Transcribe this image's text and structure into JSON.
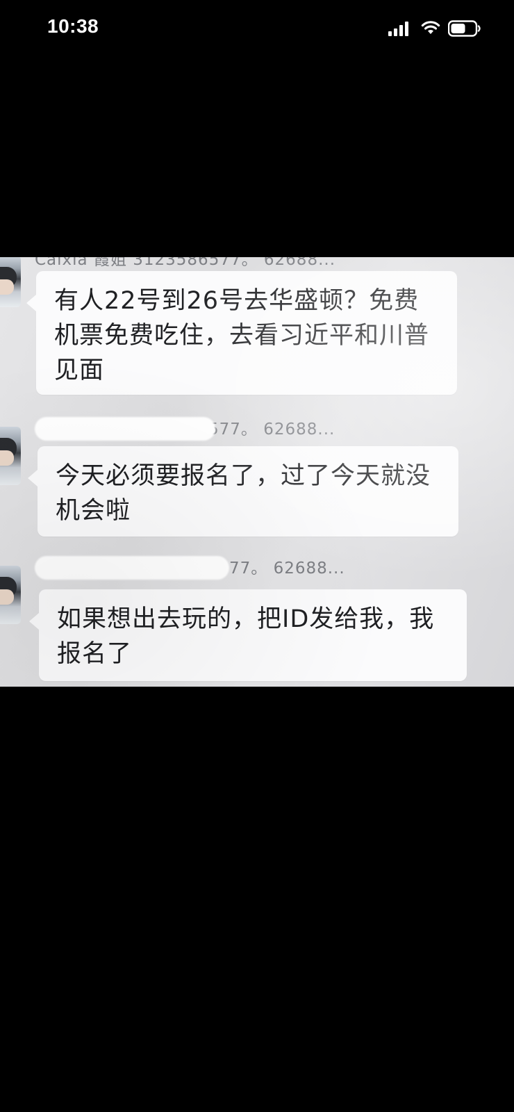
{
  "status_bar": {
    "time": "10:38"
  },
  "messages": [
    {
      "sender_visible_text": "Caixia 霞姐 3123586577。 62688...",
      "text_lines": [
        "有人22号到26号去华盛顿？免费",
        "机票免费吃住，去看习近平和川普",
        "见面"
      ]
    },
    {
      "sender_visible_text": "577。 62688...",
      "text_lines": [
        "今天必须要报名了，过了今天就没",
        "机会啦"
      ]
    },
    {
      "sender_visible_text": "77。 62688...",
      "text_lines": [
        "如果想出去玩的，把ID发给我，我",
        "报名了"
      ]
    }
  ],
  "icons": [
    "signal-icon",
    "wifi-icon",
    "battery-icon"
  ]
}
